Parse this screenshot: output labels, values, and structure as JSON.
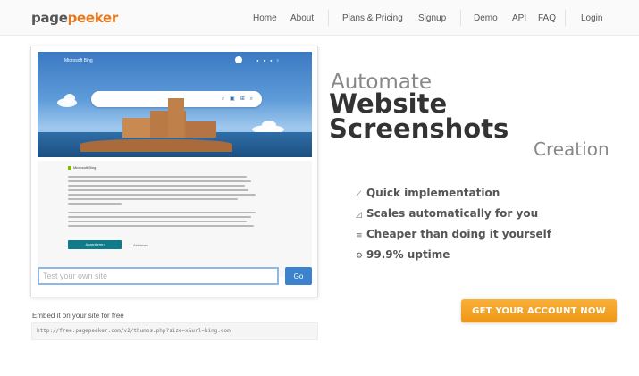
{
  "header": {
    "logo_part1": "page",
    "logo_part2": "peeker",
    "nav": {
      "home": "Home",
      "about": "About",
      "plans": "Plans & Pricing",
      "signup": "Signup",
      "demo": "Demo",
      "api": "API",
      "faq": "FAQ",
      "login": "Login"
    }
  },
  "preview": {
    "bing_brand": "Microsoft Bing",
    "consent_brand": "Microsoft Bing",
    "accept_label": "Akzeptieren",
    "reject_label": "Ablehnen"
  },
  "test": {
    "placeholder": "Test your own site",
    "go_label": "Go"
  },
  "embed": {
    "label": "Embed it on your site for free",
    "code": "http://free.pagepeeker.com/v2/thumbs.php?size=x&url=bing.com"
  },
  "hero": {
    "automate": "Automate",
    "website": "Website",
    "screenshots": "Screenshots",
    "creation": "Creation"
  },
  "features": [
    {
      "icon": "pencil-icon",
      "glyph": "⟋",
      "text": "Quick implementation"
    },
    {
      "icon": "scale-icon",
      "glyph": "◿",
      "text": "Scales automatically for you"
    },
    {
      "icon": "list-icon",
      "glyph": "≡",
      "text": "Cheaper than doing it yourself"
    },
    {
      "icon": "gear-icon",
      "glyph": "⚙",
      "text": "99.9% uptime"
    }
  ],
  "cta": {
    "label": "GET YOUR ACCOUNT NOW"
  },
  "colors": {
    "brand_orange": "#e8781e",
    "cta_orange": "#f5a623",
    "go_blue": "#3b83cf"
  }
}
